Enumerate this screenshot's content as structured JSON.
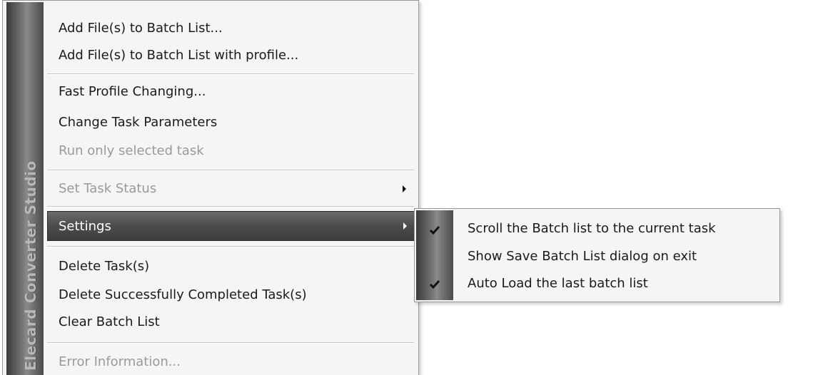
{
  "app": {
    "sidebar_brand": "Elecard Converter Studio"
  },
  "menu": {
    "items": [
      {
        "label": "Add File(s) to Batch List...",
        "disabled": false
      },
      {
        "label": "Add File(s) to Batch List with profile...",
        "disabled": false
      },
      {
        "label": "Fast Profile Changing...",
        "disabled": false
      },
      {
        "label": "Change Task Parameters",
        "disabled": false
      },
      {
        "label": "Run only selected task",
        "disabled": true
      },
      {
        "label": "Set Task Status",
        "disabled": true,
        "has_submenu": true
      },
      {
        "label": "Settings",
        "disabled": false,
        "has_submenu": true,
        "highlighted": true
      },
      {
        "label": "Delete Task(s)",
        "disabled": false
      },
      {
        "label": "Delete Successfully Completed Task(s)",
        "disabled": false
      },
      {
        "label": "Clear Batch List",
        "disabled": false
      },
      {
        "label": "Error Information...",
        "disabled": true
      }
    ]
  },
  "submenu": {
    "items": [
      {
        "label": "Scroll the Batch list to the current task",
        "checked": true
      },
      {
        "label": "Show Save Batch List dialog on exit",
        "checked": false
      },
      {
        "label": "Auto Load the last batch list",
        "checked": true
      }
    ]
  },
  "icons": {
    "submenu_arrow": "chevron-right-icon",
    "checkmark": "checkmark-icon"
  },
  "colors": {
    "menu_background": "#f5f5f5",
    "highlight": "#4c4c4c",
    "disabled_text": "#9a9a9a",
    "sidebar_text": "#b8b8b8"
  }
}
